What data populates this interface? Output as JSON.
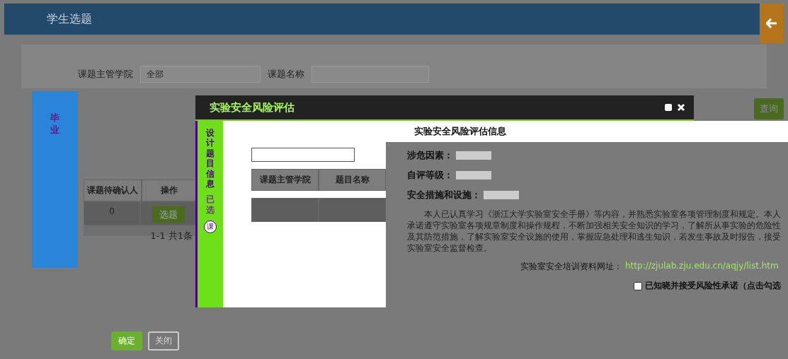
{
  "header": {
    "title": "学生选题"
  },
  "filters": [
    {
      "label": "课题主管学院",
      "kind": "select",
      "value": "全部"
    },
    {
      "label": "课题名称",
      "kind": "input"
    }
  ],
  "query_button": "查询",
  "sidebar": {
    "label": "毕业"
  },
  "table": {
    "columns": [
      "课题待确认人",
      "操作"
    ],
    "rows": [
      {
        "cells": [
          "0"
        ],
        "action": "选题"
      }
    ],
    "pagination": "1-1  共1条"
  },
  "footer_buttons": [
    {
      "label": "确定",
      "kind": "primary"
    },
    {
      "label": "关闭",
      "kind": "default"
    }
  ],
  "modal": {
    "title": "实验安全风险评估",
    "steps": [
      {
        "label": "设计题目信息",
        "selected": true
      },
      {
        "label": "已选",
        "selected": false
      }
    ],
    "step_badge": "课",
    "topic_table": {
      "columns": [
        "课题主管学院",
        "题目名称"
      ]
    },
    "info": {
      "heading": "实验安全风险评估信息",
      "fields": [
        {
          "label": "涉危因素："
        },
        {
          "label": "自评等级："
        },
        {
          "label": "安全措施和设施："
        }
      ],
      "statement": "本人已认真学习《浙江大学实验室安全手册》等内容，并熟悉实验室各项管理制度和规定。本人承诺遵守实验室各项规章制度和操作规程，不断加强相关安全知识的学习，了解所从事实验的危险性及其防范措施，了解实验室安全设施的使用，掌握应急处理和逃生知识，若发生事故及时报告，接受实验室安全监督检查。",
      "link_label": "实验室安全培训资料网址：",
      "link": "http://zjulab.zju.edu.cn/aqjy/list.htm",
      "agree": {
        "label": "已知晓并接受风险性承诺（点击勾选",
        "checked": false
      }
    }
  }
}
